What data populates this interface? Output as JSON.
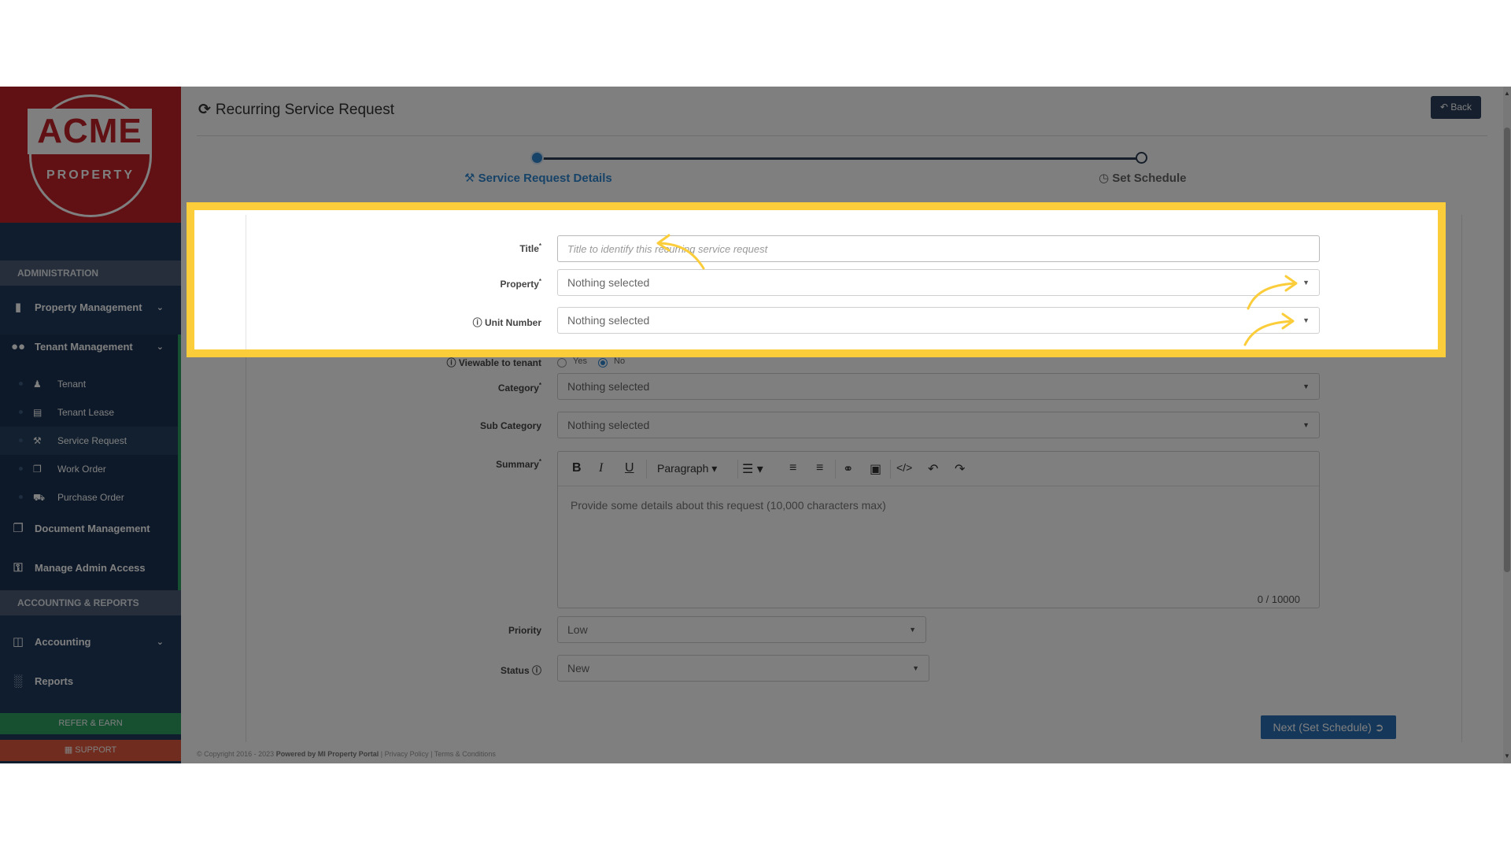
{
  "brand": {
    "logo_text": "ACME",
    "logo_sub": "PROPERTY",
    "color_primary": "#c22027",
    "sidebar_color": "#1e3a5f",
    "accent": "#2e86d0",
    "highlight": "#fbcd3b"
  },
  "sidebar": {
    "section_admin": "ADMINISTRATION",
    "section_accounting": "ACCOUNTING & REPORTS",
    "items": [
      {
        "label": "Property Management",
        "icon": "building-icon"
      },
      {
        "label": "Tenant Management",
        "icon": "users-icon"
      },
      {
        "label": "Document Management",
        "icon": "documents-icon"
      },
      {
        "label": "Manage Admin Access",
        "icon": "key-icon"
      },
      {
        "label": "Accounting",
        "icon": "money-icon"
      },
      {
        "label": "Reports",
        "icon": "bar-chart-icon"
      }
    ],
    "sub_items": [
      {
        "label": "Tenant",
        "icon": "user-icon"
      },
      {
        "label": "Tenant Lease",
        "icon": "calendar-icon"
      },
      {
        "label": "Service Request",
        "icon": "wrench-icon"
      },
      {
        "label": "Work Order",
        "icon": "copy-icon"
      },
      {
        "label": "Purchase Order",
        "icon": "truck-icon"
      }
    ],
    "refer_label": "REFER & EARN",
    "support_label": "SUPPORT"
  },
  "header": {
    "title": "Recurring Service Request",
    "back_label": "Back"
  },
  "steps": [
    {
      "label": "Service Request Details",
      "active": true
    },
    {
      "label": "Set Schedule",
      "active": false
    }
  ],
  "form": {
    "title_label": "Title",
    "title_placeholder": "Title to identify this recurring service request",
    "property_label": "Property",
    "property_value": "Nothing selected",
    "unit_label": "Unit Number",
    "unit_value": "Nothing selected",
    "viewable_label": "Viewable to tenant",
    "viewable_yes": "Yes",
    "viewable_no": "No",
    "category_label": "Category",
    "category_value": "Nothing selected",
    "subcategory_label": "Sub Category",
    "subcategory_value": "Nothing selected",
    "summary_label": "Summary",
    "editor_format": "Paragraph",
    "summary_placeholder": "Provide some details about this request (10,000 characters max)",
    "summary_count": "0 / 10000",
    "priority_label": "Priority",
    "priority_value": "Low",
    "status_label": "Status",
    "status_value": "New",
    "next_label": "Next (Set Schedule)"
  },
  "footer": {
    "copyright": "© Copyright 2016 - 2023",
    "powered": "Powered by MI Property Portal",
    "links": "| Privacy Policy | Terms & Conditions"
  }
}
